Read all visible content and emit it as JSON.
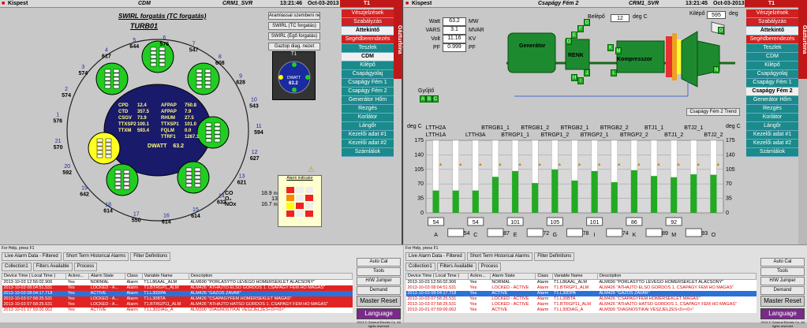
{
  "left": {
    "titlebar": {
      "app": "Kispest",
      "screen": "CDM",
      "server": "CRM1_SVR",
      "time": "13:21:46",
      "date": "Oct-03-2013",
      "unit": "T1"
    },
    "title1": "SWIRL forgatás (TC forgatás)",
    "title2": "TURB01",
    "buttons": [
      "Aramlassal szembeni nezet",
      "SWIRL (TC forgatás)",
      "SWIRL (Égő forgatás)",
      "Gaztop diag. nezet"
    ],
    "ring": [
      {
        "id": "1",
        "val": "576"
      },
      {
        "id": "2",
        "val": "574"
      },
      {
        "id": "3",
        "val": "574"
      },
      {
        "id": "4",
        "val": "617"
      },
      {
        "id": "5",
        "val": "644"
      },
      {
        "id": "6",
        "val": "576"
      },
      {
        "id": "7",
        "val": "547"
      },
      {
        "id": "8",
        "val": "608"
      },
      {
        "id": "9",
        "val": "628"
      },
      {
        "id": "10",
        "val": "543"
      },
      {
        "id": "11",
        "val": "594"
      },
      {
        "id": "12",
        "val": "627"
      },
      {
        "id": "13",
        "val": "621"
      },
      {
        "id": "14",
        "val": "632"
      },
      {
        "id": "15",
        "val": "614"
      },
      {
        "id": "16",
        "val": "614"
      },
      {
        "id": "17",
        "val": "550"
      },
      {
        "id": "18",
        "val": "614"
      },
      {
        "id": "19",
        "val": "642"
      },
      {
        "id": "20",
        "val": "592"
      },
      {
        "id": "21",
        "val": "570"
      }
    ],
    "center": {
      "rows": [
        [
          "CPD",
          "12.4",
          "AFPAP",
          "750.8"
        ],
        [
          "CTD",
          "357.5",
          "AFPAP",
          "7.9"
        ],
        [
          "CSGV",
          "73.9",
          "RHUM",
          "27.5"
        ],
        [
          "TTXSP2",
          "100.1",
          "TTXSP1",
          "101.0"
        ],
        [
          "TTXM",
          "593.4",
          "FQLM",
          "0.0"
        ],
        [
          "",
          "",
          "TTRF1",
          "1267.1"
        ]
      ],
      "dwatt_label": "DWATT",
      "dwatt_val": "63.2"
    },
    "gauge": {
      "title": "T1",
      "label": "DWATT",
      "val": "63.2"
    },
    "emissions": [
      {
        "label": "CO",
        "val": "18.9",
        "unit": "mg/m3"
      },
      {
        "label": "O₂",
        "val": "13.6",
        "unit": "%"
      },
      {
        "label": "NOx",
        "val": "16.7",
        "mg": "mg/m3",
        "unit": "mg/m3"
      }
    ],
    "alarm_box_title": "Alarm indicator"
  },
  "menu": {
    "tab": "Gázturbina",
    "items": [
      "Vészjelzések",
      "Szabályzás",
      "Áttekintő",
      "Segédberendezés",
      "Teszlek",
      "CDM",
      "Kilépő",
      "Csapágyolaj",
      "Csapágy Fém 1",
      "Csapágy Fém 2",
      "Generátor Hőm",
      "Rezgés",
      "Korlátor",
      "Lángőr",
      "Kezelői adat #1",
      "Kezelői adat #2",
      "Számlálok"
    ]
  },
  "right": {
    "titlebar": {
      "app": "Kispest",
      "screen": "Csapágy Fém 2",
      "server": "CRM1_SVR",
      "time": "13:21:45",
      "date": "Oct-03-2013",
      "unit": "T1"
    },
    "readings": [
      {
        "label": "Watt",
        "val": "63.2",
        "unit": "MW"
      },
      {
        "label": "VARS",
        "val": "3.1",
        "unit": "MVAR"
      },
      {
        "label": "Volt",
        "val": "11.16",
        "unit": "KV"
      },
      {
        "label": "PF",
        "val": "0.999",
        "unit": "PF"
      }
    ],
    "belepo": {
      "label": "Belépő",
      "val": "12",
      "unit": "deg C"
    },
    "kilepo": {
      "label": "Kilépő",
      "val": "595",
      "unit": "deg"
    },
    "generator_label": "Generátor",
    "renk_label": "RENK",
    "kompresszor_label": "Kompresszor",
    "gyujto_label": "Gyűjtő",
    "trend_button": "Csapágy Fém 2 Trend",
    "letters": [
      "A",
      "B",
      "C",
      "D",
      "E",
      "F",
      "G",
      "H",
      "I",
      "J",
      "K",
      "L",
      "M",
      "N",
      "O"
    ]
  },
  "chart_data": {
    "type": "bar",
    "ylabel": "deg C",
    "ylabel_right": "deg C",
    "yticks": [
      "0",
      "35",
      "70",
      "105",
      "140",
      "175"
    ],
    "ylim": [
      0,
      175
    ],
    "series_labels_top": [
      "LTTH2A",
      "BTRGB1_1",
      "BTRGB1_2",
      "BTRGB2_1",
      "BTRGB2_2",
      "BTJ1_1",
      "BTJ2_1"
    ],
    "series_labels_bottom": [
      "LTTH1A",
      "LTTH3A",
      "BTRGP1_1",
      "BTRGP1_2",
      "BTRGP2_1",
      "BTRGP2_2",
      "BTJ1_2",
      "BTJ2_2"
    ],
    "categories": [
      "A",
      "B",
      "C",
      "D",
      "E",
      "F",
      "G",
      "H",
      "I",
      "J",
      "K",
      "L",
      "M",
      "N",
      "O"
    ],
    "values": [
      54,
      54,
      54,
      87,
      101,
      72,
      105,
      78,
      101,
      74,
      103,
      89,
      86,
      93,
      92
    ],
    "value_labels": [
      "54",
      "54",
      "54",
      "87",
      "101",
      "72",
      "105",
      "78",
      "101",
      "74",
      "103",
      "89",
      "86",
      "93",
      "92"
    ],
    "value_labels_shown": [
      [
        "54",
        "54",
        "101",
        "105",
        "101",
        "86",
        "92"
      ],
      [
        "54",
        "87",
        "72",
        "78",
        "74",
        "89",
        "93"
      ]
    ]
  },
  "alarm_left": {
    "help": "For Help, press F1",
    "tabs": [
      "Live Alarm Data - Filtered",
      "Short Term Historical Alarms",
      "Filter Definitions"
    ],
    "toolbar": [
      "Collection1",
      "Filters Available",
      "Process"
    ],
    "headers": [
      "Device Time ( Local Time )",
      "Ackno...",
      "Alarm State",
      "Class",
      "Variable Name",
      "Description"
    ],
    "rows": [
      {
        "time": "2013-10-03 12:56:02.906",
        "ack": "Yes",
        "state": "NORMAL",
        "class": "Alarm",
        "var": "T1.L86AAL_ALM",
        "desc": "ALM690 \"PORLASYTO LEVEGO HOMERSEKLET ALACSONY\"",
        "style": "row-normal"
      },
      {
        "time": "2013-10-03 08:04:51.531",
        "ack": "Yes",
        "state": "LOCKED - A...",
        "class": "Alarm",
        "var": "T1.BTRGP1_ALM",
        "desc": "ALM426 \"ATHAJTO ELSO GORDOS 1. CSAPAGY FEM HO MAGAS\"",
        "style": "row-redfill"
      },
      {
        "time": "2013-10-03 08:04:17.718",
        "ack": "Yes",
        "state": "ACTIVE",
        "class": "Alarm",
        "var": "T1.L30DPA",
        "desc": "ALM426 \"GAZOS ZAVAR\"",
        "style": "row-sel"
      },
      {
        "time": "2013-10-03 07:58:25.531",
        "ack": "Yes",
        "state": "LOCKED - A...",
        "class": "Alarm",
        "var": "T1.L30BTA",
        "desc": "ALM426 \"CSAPAGYFEM HOMERSEKLET MAGAS\"",
        "style": "row-redfill"
      },
      {
        "time": "2013-10-03 07:58:25.531",
        "ack": "Yes",
        "state": "LOCKED - A...",
        "class": "Alarm",
        "var": "T1.BTRGP11_ALM",
        "desc": "ALM426 \"ATHAJTO HATSO GORDOS 1. CSAPAGY FEM HO MAGAS\"",
        "style": "row-redfill"
      },
      {
        "time": "2013-10-01 07:59:00.062",
        "ack": "Yes",
        "state": "ACTIVE",
        "class": "Alarm",
        "var": "T1.L30DIAG_A",
        "desc": "ALM300 \"DIAGNOSTIKAI VESZJELZES<0><0>\"",
        "style": "row-red"
      }
    ],
    "side_buttons": [
      "Auto Cal",
      "Tools",
      "H/W Jumper",
      "Demand"
    ],
    "master_reset": "Master Reset",
    "language": "Language",
    "copyright": "2013 © General Electric Co. All rights reserved"
  },
  "alarm_right": {
    "help": "For Help, press F1",
    "tabs": [
      "Live Alarm Data - Filtered",
      "Short Term Historical Alarms",
      "Filter Definitions"
    ],
    "toolbar": [
      "Collection1",
      "Filters Available",
      "Process"
    ],
    "headers": [
      "Device Time ( Local Time )",
      "Ackno...",
      "Alarm State",
      "Class",
      "Variable Name",
      "Description"
    ],
    "rows": [
      {
        "time": "2013-10-03 12:56:02.906",
        "ack": "Yes",
        "state": "NORMAL",
        "class": "Alarm",
        "var": "T1.L86AAL_ALM",
        "desc": "ALM690 \"PORLASYTO LEVEGO HOMERSEKLET ALACSONY\"",
        "style": "row-normal"
      },
      {
        "time": "2013-10-03 08:04:51.531",
        "ack": "Yes",
        "state": "LOCKED - ACTIVE",
        "class": "Alarm",
        "var": "T1.BTRGP1_ALM",
        "desc": "ALM426 \"ATHAJTO ELSO GORDOS 1. CSAPAGY FEM HO MAGAS\"",
        "style": "row-red"
      },
      {
        "time": "2013-10-03 08:04:17.718",
        "ack": "Yes",
        "state": "ACTIVE",
        "class": "Alarm",
        "var": "T1.L30DPA",
        "desc": "ALM426 \"GAZOS ZAVAR\"",
        "style": "row-sel"
      },
      {
        "time": "2013-10-03 07:58:25.531",
        "ack": "Yes",
        "state": "LOCKED - ACTIVE",
        "class": "Alarm",
        "var": "T1.L30BTA",
        "desc": "ALM426 \"CSAPAGYFEM HOMERSEKLET MAGAS\"",
        "style": "row-red"
      },
      {
        "time": "2013-10-03 07:58:25.531",
        "ack": "Yes",
        "state": "LOCKED - ACTIVE",
        "class": "Alarm",
        "var": "T1.BTRGP11_ALM",
        "desc": "ALM426 \"ATHAJTO HATSO GORDOS 1. CSAPAGY FEM HO MAGAS\"",
        "style": "row-red"
      },
      {
        "time": "2013-10-01 07:59:00.062",
        "ack": "Yes",
        "state": "ACTIVE",
        "class": "Alarm",
        "var": "T1.L30DIAG_A",
        "desc": "ALM300 \"DIAGNOSTIKAI VESZJELZES<0><0>\"",
        "style": "row-red"
      }
    ],
    "side_buttons": [
      "Auto Cal",
      "Tools",
      "H/W Jumper",
      "Demand"
    ],
    "master_reset": "Master Reset",
    "language": "Language",
    "copyright": "2013 © General Electric Co. All rights reserved"
  },
  "colors": {
    "menu_red": "#d02020",
    "menu_teal": "#1a8a8a",
    "bar_green": "#22aa22",
    "navy": "#1a1a6a",
    "language": "#7a2a8a"
  }
}
